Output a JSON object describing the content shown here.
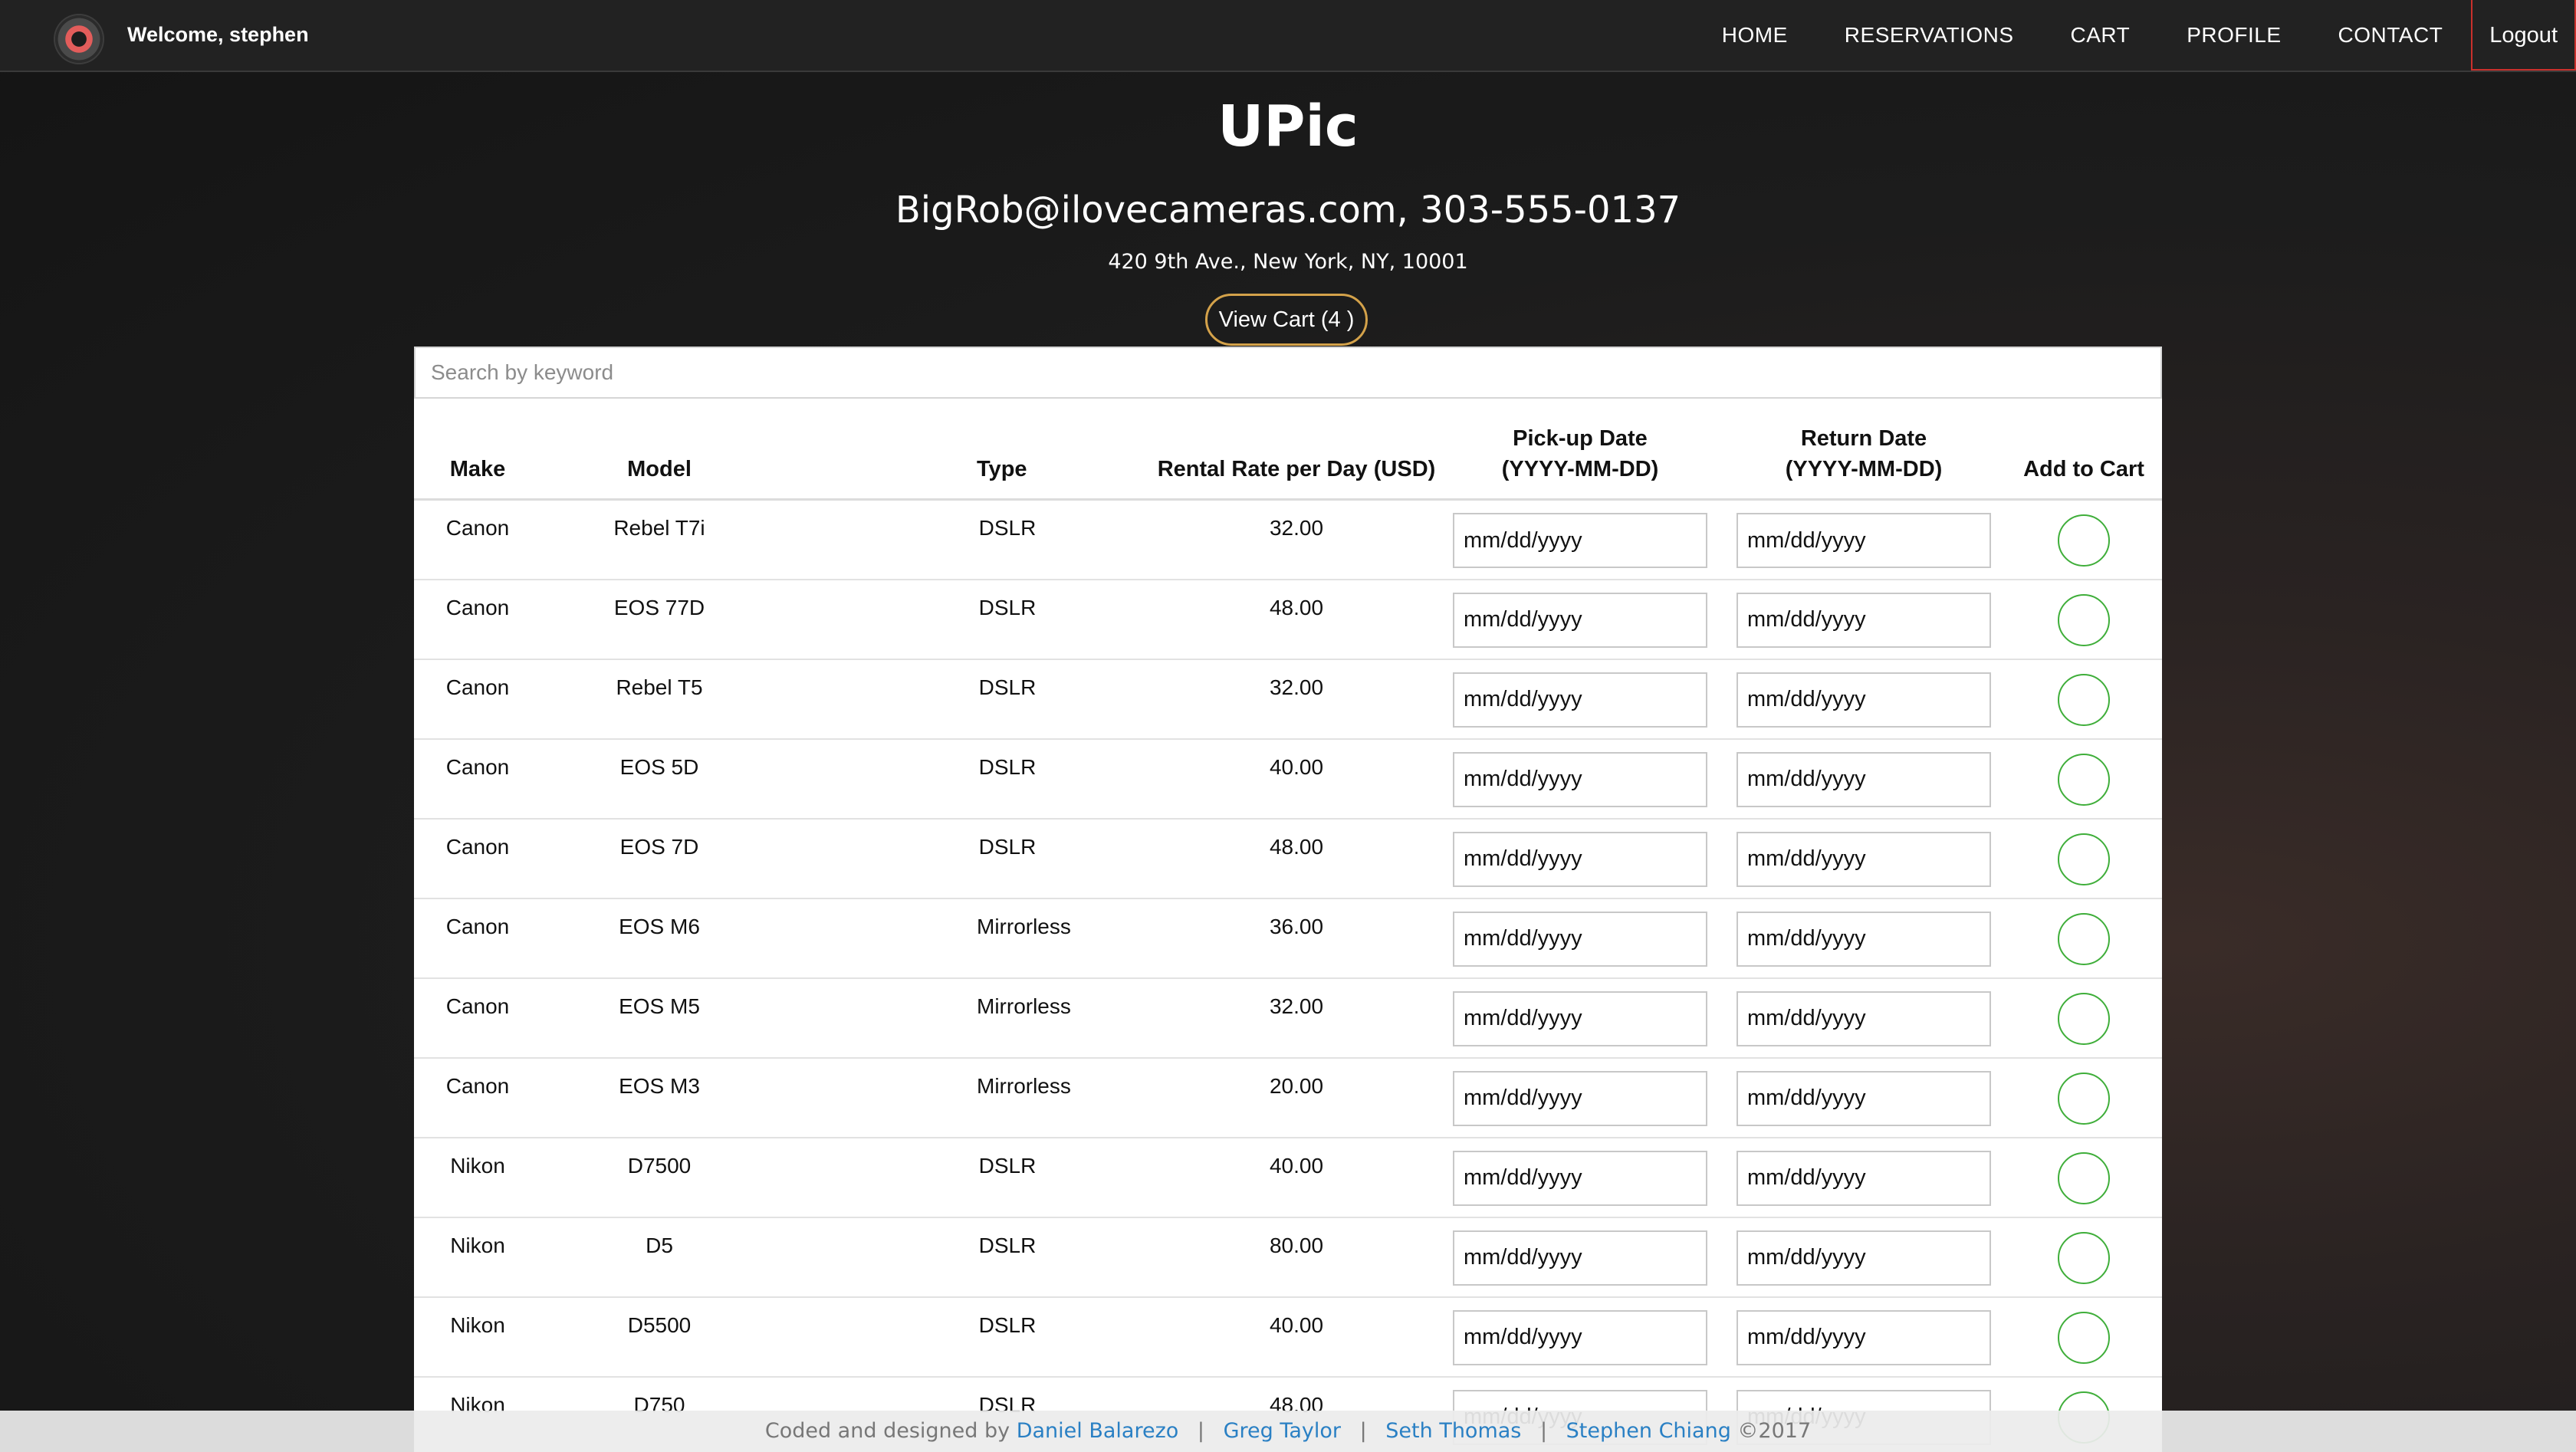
{
  "nav": {
    "welcome": "Welcome, stephen",
    "links": [
      "HOME",
      "RESERVATIONS",
      "CART",
      "PROFILE",
      "CONTACT"
    ],
    "logout": "Logout"
  },
  "header": {
    "title": "UPic",
    "contact": "BigRob@ilovecameras.com, 303-555-0137",
    "address": "420 9th Ave., New York, NY, 10001",
    "view_cart": "View Cart (4 )"
  },
  "search": {
    "placeholder": "Search by keyword",
    "value": ""
  },
  "table": {
    "headers": {
      "make": "Make",
      "model": "Model",
      "type": "Type",
      "rate": "Rental Rate per Day (USD)",
      "pickup_line1": "Pick-up Date",
      "pickup_line2": "(YYYY-MM-DD)",
      "return_line1": "Return Date",
      "return_line2": "(YYYY-MM-DD)",
      "add": "Add to Cart"
    },
    "date_placeholder": "mm/dd/yyyy",
    "rows": [
      {
        "make": "Canon",
        "model": "Rebel T7i",
        "type": "DSLR",
        "rate": "32.00"
      },
      {
        "make": "Canon",
        "model": "EOS 77D",
        "type": "DSLR",
        "rate": "48.00"
      },
      {
        "make": "Canon",
        "model": "Rebel T5",
        "type": "DSLR",
        "rate": "32.00"
      },
      {
        "make": "Canon",
        "model": "EOS 5D",
        "type": "DSLR",
        "rate": "40.00"
      },
      {
        "make": "Canon",
        "model": "EOS 7D",
        "type": "DSLR",
        "rate": "48.00"
      },
      {
        "make": "Canon",
        "model": "EOS M6",
        "type": "Mirrorless",
        "rate": "36.00"
      },
      {
        "make": "Canon",
        "model": "EOS M5",
        "type": "Mirrorless",
        "rate": "32.00"
      },
      {
        "make": "Canon",
        "model": "EOS M3",
        "type": "Mirrorless",
        "rate": "20.00"
      },
      {
        "make": "Nikon",
        "model": "D7500",
        "type": "DSLR",
        "rate": "40.00"
      },
      {
        "make": "Nikon",
        "model": "D5",
        "type": "DSLR",
        "rate": "80.00"
      },
      {
        "make": "Nikon",
        "model": "D5500",
        "type": "DSLR",
        "rate": "40.00"
      },
      {
        "make": "Nikon",
        "model": "D750",
        "type": "DSLR",
        "rate": "48.00"
      }
    ]
  },
  "footer": {
    "prefix": "Coded and designed by",
    "authors": [
      "Daniel Balarezo",
      "Greg Taylor",
      "Seth Thomas",
      "Stephen Chiang"
    ],
    "separator": "|",
    "copyright": "©2017"
  },
  "colors": {
    "navbar": "#222222",
    "logout_border": "#c9302c",
    "view_cart_border": "#d4a24a",
    "toggle_green": "#3fae3a",
    "footer_link": "#2a80c4"
  }
}
